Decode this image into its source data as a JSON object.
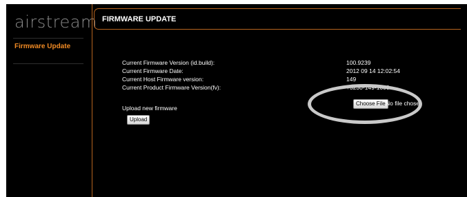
{
  "sidebar": {
    "logo": "airstream",
    "items": [
      {
        "label": "Firmware Update"
      }
    ]
  },
  "header": {
    "title": "FIRMWARE UPDATE"
  },
  "info": [
    {
      "label": "Current Firmware Version (id.build):",
      "value": "100.9239"
    },
    {
      "label": "Current Firmware Date:",
      "value": "2012 09 14  12:02:54"
    },
    {
      "label": "Current Host Firmware version:",
      "value": "149"
    },
    {
      "label": "Current Product Firmware Version(fv):",
      "value": "+3230-149-1000"
    }
  ],
  "upload": {
    "label": "Upload new firmware",
    "choose_file_label": "Choose File",
    "file_status": "No file chosen",
    "upload_button_label": "Upload"
  },
  "annotation": {
    "highlight_color": "#c9c9c9"
  }
}
